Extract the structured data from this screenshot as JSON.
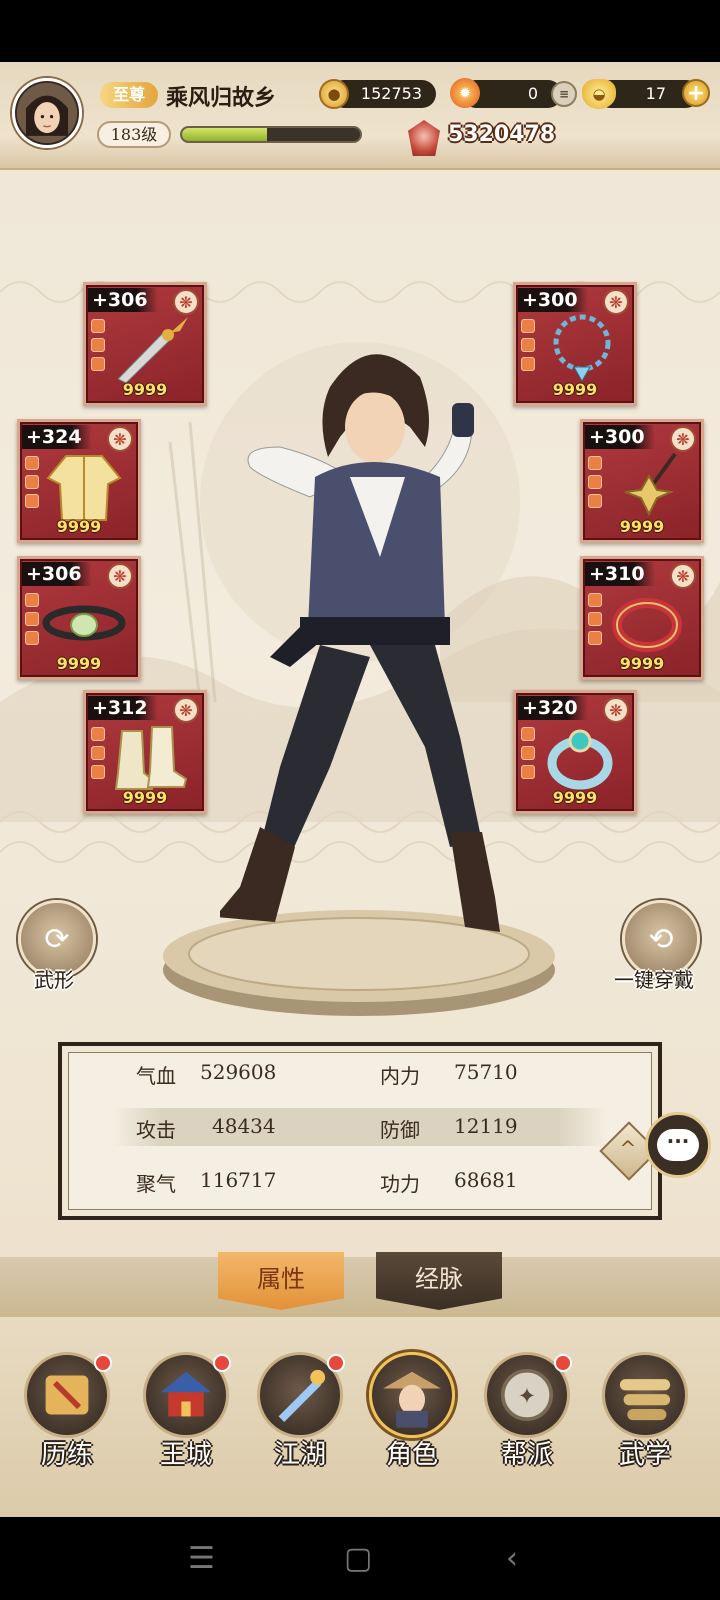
{
  "player": {
    "vip_label": "至尊",
    "name": "乘风归故乡",
    "level": "183级",
    "xp_fraction": 0.48
  },
  "resources": {
    "coins": "152753",
    "flame": "0",
    "yuanbao": "17",
    "power": "5320478"
  },
  "equipment": {
    "left": [
      {
        "plus": "+306",
        "count": "9999",
        "icon": "dagger-icon"
      },
      {
        "plus": "+324",
        "count": "9999",
        "icon": "robe-icon"
      },
      {
        "plus": "+306",
        "count": "9999",
        "icon": "belt-icon"
      },
      {
        "plus": "+312",
        "count": "9999",
        "icon": "boots-icon"
      }
    ],
    "right": [
      {
        "plus": "+300",
        "count": "9999",
        "icon": "necklace-icon"
      },
      {
        "plus": "+300",
        "count": "9999",
        "icon": "pendant-icon"
      },
      {
        "plus": "+310",
        "count": "9999",
        "icon": "bracelet-icon"
      },
      {
        "plus": "+320",
        "count": "9999",
        "icon": "ring-icon"
      }
    ]
  },
  "buttons": {
    "martial_form": "武形",
    "equip_all": "一键穿戴"
  },
  "stats": [
    {
      "label": "气血",
      "value": "529608"
    },
    {
      "label": "内力",
      "value": "75710"
    },
    {
      "label": "攻击",
      "value": "48434"
    },
    {
      "label": "防御",
      "value": "12119"
    },
    {
      "label": "聚气",
      "value": "116717"
    },
    {
      "label": "功力",
      "value": "68681"
    }
  ],
  "tabs": {
    "attributes": "属性",
    "meridians": "经脉"
  },
  "nav": [
    {
      "label": "历练",
      "badge": true
    },
    {
      "label": "王城",
      "badge": true
    },
    {
      "label": "江湖",
      "badge": true
    },
    {
      "label": "角色",
      "badge": false,
      "active": true
    },
    {
      "label": "帮派",
      "badge": true
    },
    {
      "label": "武学",
      "badge": false
    }
  ],
  "colors": {
    "equip_bg": "#9a2b31",
    "accent_gold": "#e39138",
    "notify_red": "#e8473c"
  }
}
